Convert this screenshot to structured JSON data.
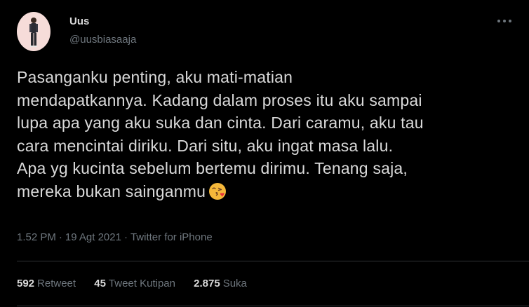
{
  "author": {
    "display_name": "Uus",
    "handle": "@uusbiasaaja",
    "avatar_bg": "#f6dcd9"
  },
  "tweet": {
    "lines": [
      "Pasanganku penting, aku mati-matian",
      "mendapatkannya. Kadang dalam proses itu aku sampai",
      "lupa apa yang aku suka dan cinta. Dari caramu, aku tau",
      "cara mencintai diriku. Dari situ, aku ingat masa lalu.",
      "Apa yg kucinta sebelum bertemu dirimu. Tenang saja,",
      "mereka bukan sainganmu"
    ],
    "emoji": "face-blowing-a-kiss-emoji"
  },
  "meta": {
    "time": "1.52 PM",
    "separator": "·",
    "date": "19 Agt 2021",
    "source": "Twitter for iPhone"
  },
  "stats": {
    "retweets": {
      "count": "592",
      "label": "Retweet"
    },
    "quotes": {
      "count": "45",
      "label": "Tweet Kutipan"
    },
    "likes": {
      "count": "2.875",
      "label": "Suka"
    }
  },
  "colors": {
    "background": "#000000",
    "text": "#d9d9d9",
    "secondary": "#6e767d",
    "divider": "#2f3336"
  }
}
